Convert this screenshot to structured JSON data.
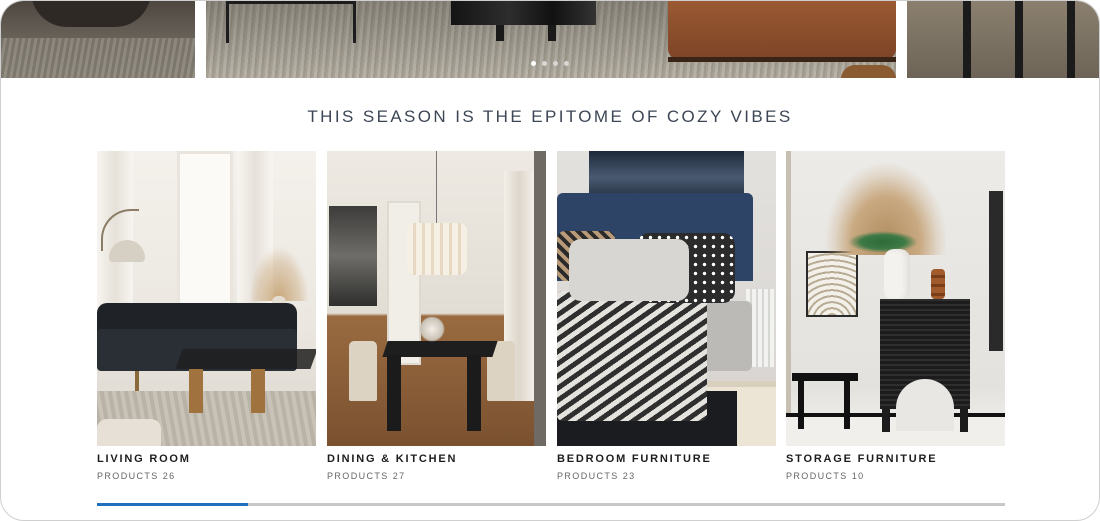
{
  "carousel": {
    "slide_count": 4,
    "active_slide_index": 0
  },
  "section": {
    "heading": "THIS SEASON IS THE EPITOME OF COZY VIBES"
  },
  "categories": [
    {
      "name": "LIVING ROOM",
      "count_label": "PRODUCTS",
      "count": "26"
    },
    {
      "name": "DINING & KITCHEN",
      "count_label": "PRODUCTS",
      "count": "27"
    },
    {
      "name": "BEDROOM FURNITURE",
      "count_label": "PRODUCTS",
      "count": "23"
    },
    {
      "name": "STORAGE FURNITURE",
      "count_label": "PRODUCTS",
      "count": "10"
    }
  ],
  "scrollbar": {
    "progress": 0.166
  },
  "colors": {
    "heading": "#3c4654",
    "scroll_thumb": "#1f6fbf",
    "scroll_track": "#c8c8c8"
  }
}
